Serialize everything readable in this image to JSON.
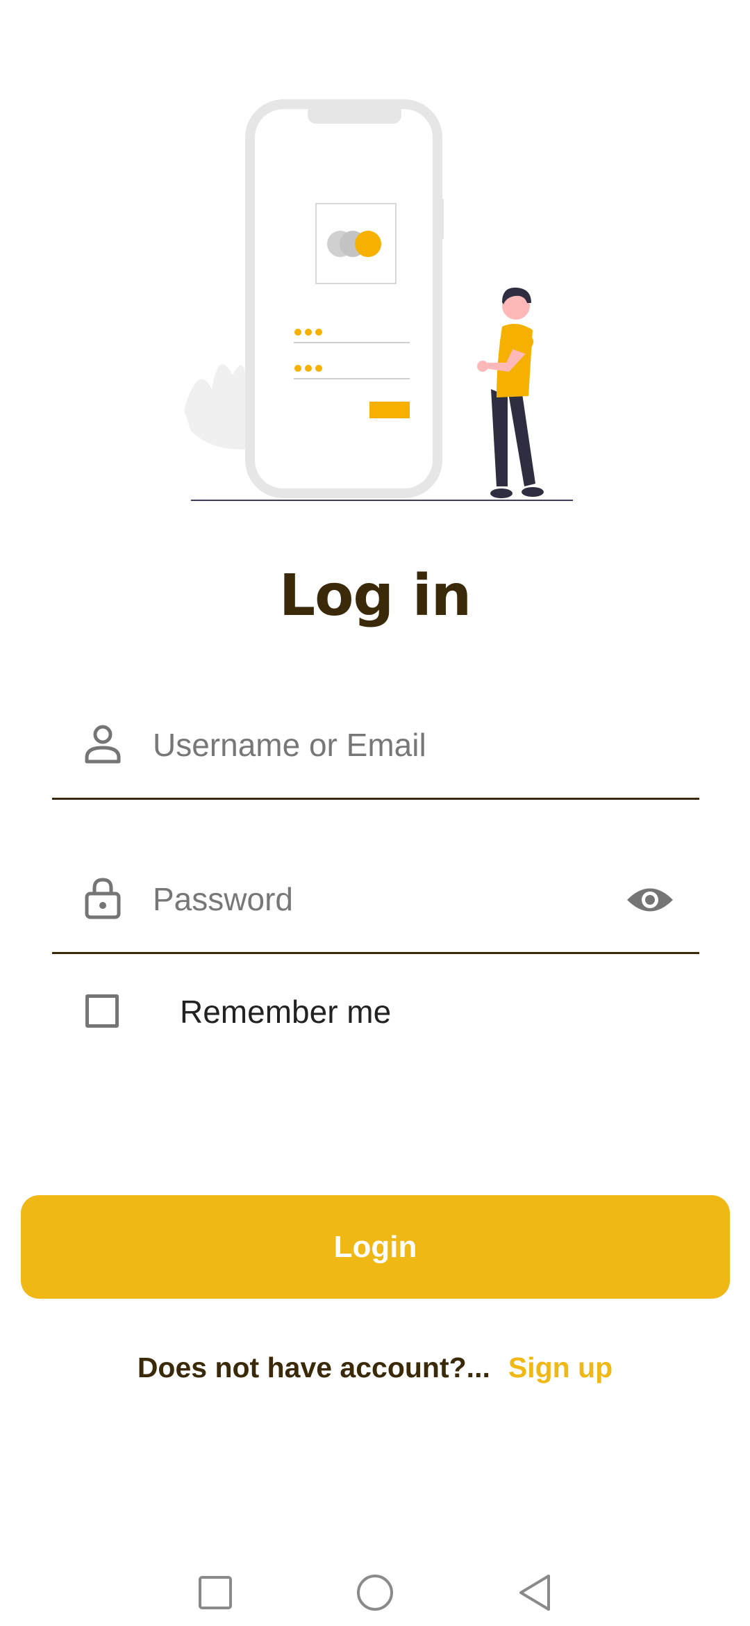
{
  "title": "Log in",
  "username_field": {
    "placeholder": "Username or Email",
    "value": "",
    "icon": "person-icon"
  },
  "password_field": {
    "placeholder": "Password",
    "value": "",
    "icon": "lock-icon",
    "toggle_icon": "eye-icon"
  },
  "remember": {
    "label": "Remember me",
    "checked": false
  },
  "login_button": {
    "label": "Login"
  },
  "signup": {
    "prompt": "Does not have account?...",
    "link": "Sign up"
  },
  "navbar": {
    "icons": [
      "recent-apps-icon",
      "home-icon",
      "back-icon"
    ]
  },
  "colors": {
    "accent": "#f0b815",
    "title": "#3a2a0a",
    "icon_gray": "#757575",
    "button_text": "#ffffff"
  }
}
